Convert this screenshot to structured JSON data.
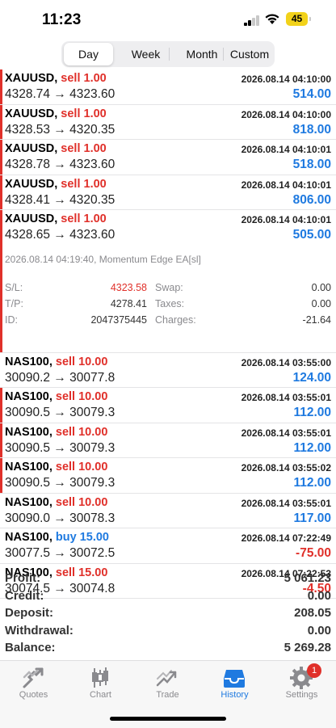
{
  "status": {
    "time": "11:23",
    "battery": "45"
  },
  "periods": {
    "day": "Day",
    "week": "Week",
    "month": "Month",
    "custom": "Custom",
    "selected": "Day"
  },
  "trades": [
    {
      "symbol": "XAUUSD",
      "side": "sell",
      "vol": "1.00",
      "date": "2026.08.14 04:10:00",
      "open": "4328.74",
      "close": "4323.60",
      "profit": "514.00"
    },
    {
      "symbol": "XAUUSD",
      "side": "sell",
      "vol": "1.00",
      "date": "2026.08.14 04:10:00",
      "open": "4328.53",
      "close": "4320.35",
      "profit": "818.00"
    },
    {
      "symbol": "XAUUSD",
      "side": "sell",
      "vol": "1.00",
      "date": "2026.08.14 04:10:01",
      "open": "4328.78",
      "close": "4323.60",
      "profit": "518.00"
    },
    {
      "symbol": "XAUUSD",
      "side": "sell",
      "vol": "1.00",
      "date": "2026.08.14 04:10:01",
      "open": "4328.41",
      "close": "4320.35",
      "profit": "806.00"
    },
    {
      "symbol": "XAUUSD",
      "side": "sell",
      "vol": "1.00",
      "date": "2026.08.14 04:10:01",
      "open": "4328.65",
      "close": "4323.60",
      "profit": "505.00"
    }
  ],
  "detail": {
    "comment": "2026.08.14 04:19:40, Momentum Edge EA[sl]",
    "sl_label": "S/L:",
    "sl": "4323.58",
    "tp_label": "T/P:",
    "tp": "4278.41",
    "id_label": "ID:",
    "id": "2047375445",
    "swap_label": "Swap:",
    "swap": "0.00",
    "taxes_label": "Taxes:",
    "taxes": "0.00",
    "charges_label": "Charges:",
    "charges": "-21.64"
  },
  "trades2": [
    {
      "symbol": "NAS100",
      "side": "sell",
      "vol": "10.00",
      "date": "2026.08.14 03:55:00",
      "open": "30090.2",
      "close": "30077.8",
      "profit": "124.00",
      "bar": false
    },
    {
      "symbol": "NAS100",
      "side": "sell",
      "vol": "10.00",
      "date": "2026.08.14 03:55:01",
      "open": "30090.5",
      "close": "30079.3",
      "profit": "112.00",
      "bar": true
    },
    {
      "symbol": "NAS100",
      "side": "sell",
      "vol": "10.00",
      "date": "2026.08.14 03:55:01",
      "open": "30090.5",
      "close": "30079.3",
      "profit": "112.00",
      "bar": true
    },
    {
      "symbol": "NAS100",
      "side": "sell",
      "vol": "10.00",
      "date": "2026.08.14 03:55:02",
      "open": "30090.5",
      "close": "30079.3",
      "profit": "112.00",
      "bar": true
    },
    {
      "symbol": "NAS100",
      "side": "sell",
      "vol": "10.00",
      "date": "2026.08.14 03:55:01",
      "open": "30090.0",
      "close": "30078.3",
      "profit": "117.00",
      "bar": false
    },
    {
      "symbol": "NAS100",
      "side": "buy",
      "vol": "15.00",
      "date": "2026.08.14 07:22:49",
      "open": "30077.5",
      "close": "30072.5",
      "profit": "-75.00",
      "bar": false
    },
    {
      "symbol": "NAS100",
      "side": "sell",
      "vol": "15.00",
      "date": "2026.08.14 07:22:53",
      "open": "30074.5",
      "close": "30074.8",
      "profit": "-4.50",
      "bar": false
    }
  ],
  "arrow": "→",
  "summary": [
    {
      "label": "Profit:",
      "value": "5 061.23"
    },
    {
      "label": "Credit:",
      "value": "0.00"
    },
    {
      "label": "Deposit:",
      "value": "208.05"
    },
    {
      "label": "Withdrawal:",
      "value": "0.00"
    },
    {
      "label": "Balance:",
      "value": "5 269.28"
    }
  ],
  "tabs": [
    {
      "label": "Quotes",
      "icon": "quotes-icon"
    },
    {
      "label": "Chart",
      "icon": "candlestick-chart-icon"
    },
    {
      "label": "Trade",
      "icon": "trade-icon"
    },
    {
      "label": "History",
      "icon": "history-inbox-icon"
    },
    {
      "label": "Settings",
      "icon": "gear-icon",
      "badge": "1"
    }
  ],
  "colors": {
    "sell": "#e0302a",
    "buy": "#1f7ae0",
    "profit_pos": "#1f7ae0",
    "profit_neg": "#e0302a",
    "tab_active": "#1f7ae0"
  }
}
